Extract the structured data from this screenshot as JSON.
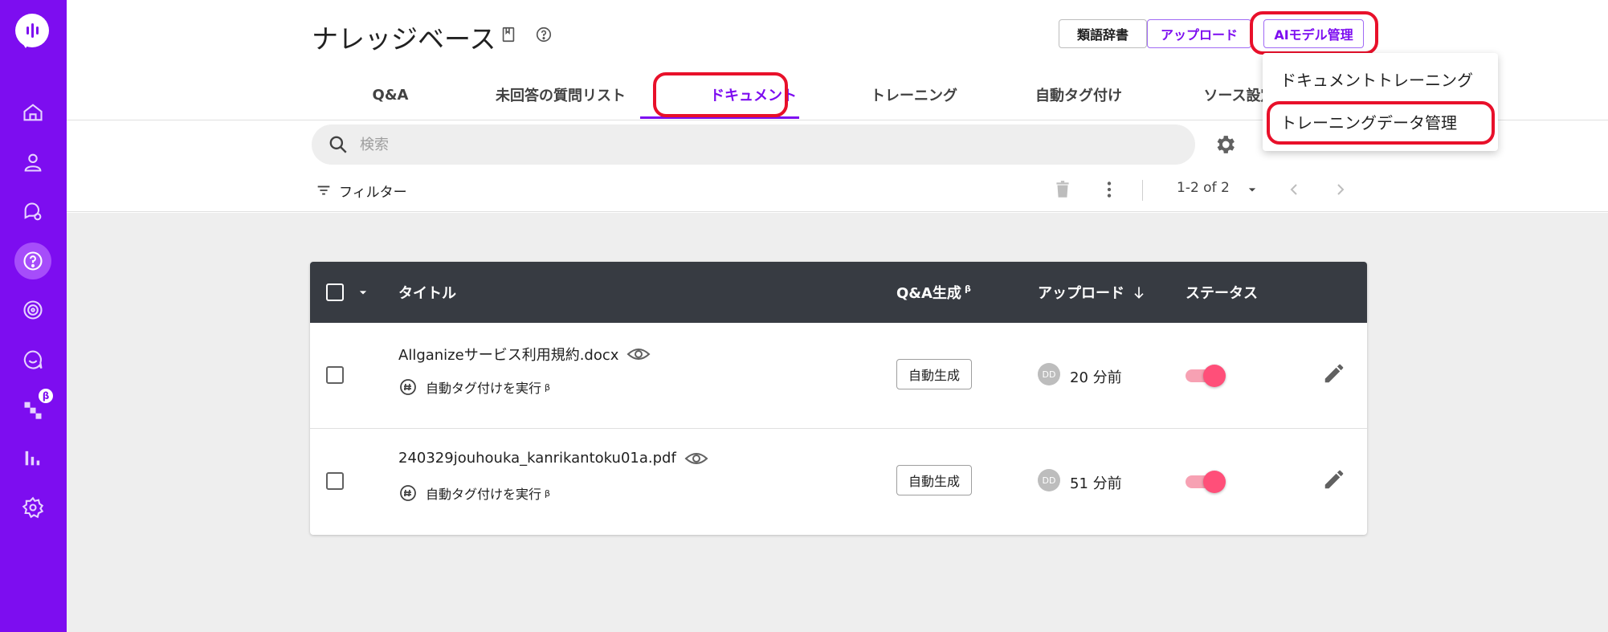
{
  "sidebar": {
    "nav_icons": [
      "home-icon",
      "user-icon",
      "chat-icon",
      "question-icon",
      "target-icon",
      "smile-chat-icon",
      "flow-icon",
      "analytics-icon",
      "settings-icon"
    ],
    "beta_badge": "β",
    "accent": "#7d0df0"
  },
  "header": {
    "title": "ナレッジベース",
    "buttons": {
      "thesaurus": "類語辞書",
      "upload": "アップロード",
      "ai_model": "AIモデル管理"
    },
    "tabs": [
      {
        "label": "Q&A"
      },
      {
        "label": "未回答の質問リスト"
      },
      {
        "label": "ドキュメント"
      },
      {
        "label": "トレーニング"
      },
      {
        "label": "自動タグ付け"
      },
      {
        "label": "ソース設定"
      }
    ],
    "active_tab": "ドキュメント"
  },
  "toolbar": {
    "search_placeholder": "検索",
    "filter_label": "フィルター",
    "pagination": "1-2 of 2"
  },
  "dropdown": {
    "items": [
      {
        "label": "ドキュメントトレーニング"
      },
      {
        "label": "トレーニングデータ管理"
      }
    ]
  },
  "table": {
    "headers": {
      "title": "タイトル",
      "qa_generate": "Q&A生成",
      "qa_beta": "β",
      "upload": "アップロード",
      "status": "ステータス"
    },
    "rows": [
      {
        "title": "Allganizeサービス利用規約.docx",
        "autotag": "自動タグ付けを実行",
        "beta": "β",
        "generate": "自動生成",
        "avatar": "DD",
        "time": "20 分前",
        "status_on": true
      },
      {
        "title": "240329jouhouka_kanrikantoku01a.pdf",
        "autotag": "自動タグ付けを実行",
        "beta": "β",
        "generate": "自動生成",
        "avatar": "DD",
        "time": "51 分前",
        "status_on": true
      }
    ]
  },
  "colors": {
    "highlight": "#e8102a",
    "header_dark": "#373b42",
    "toggle_on": "#ff4f79"
  }
}
